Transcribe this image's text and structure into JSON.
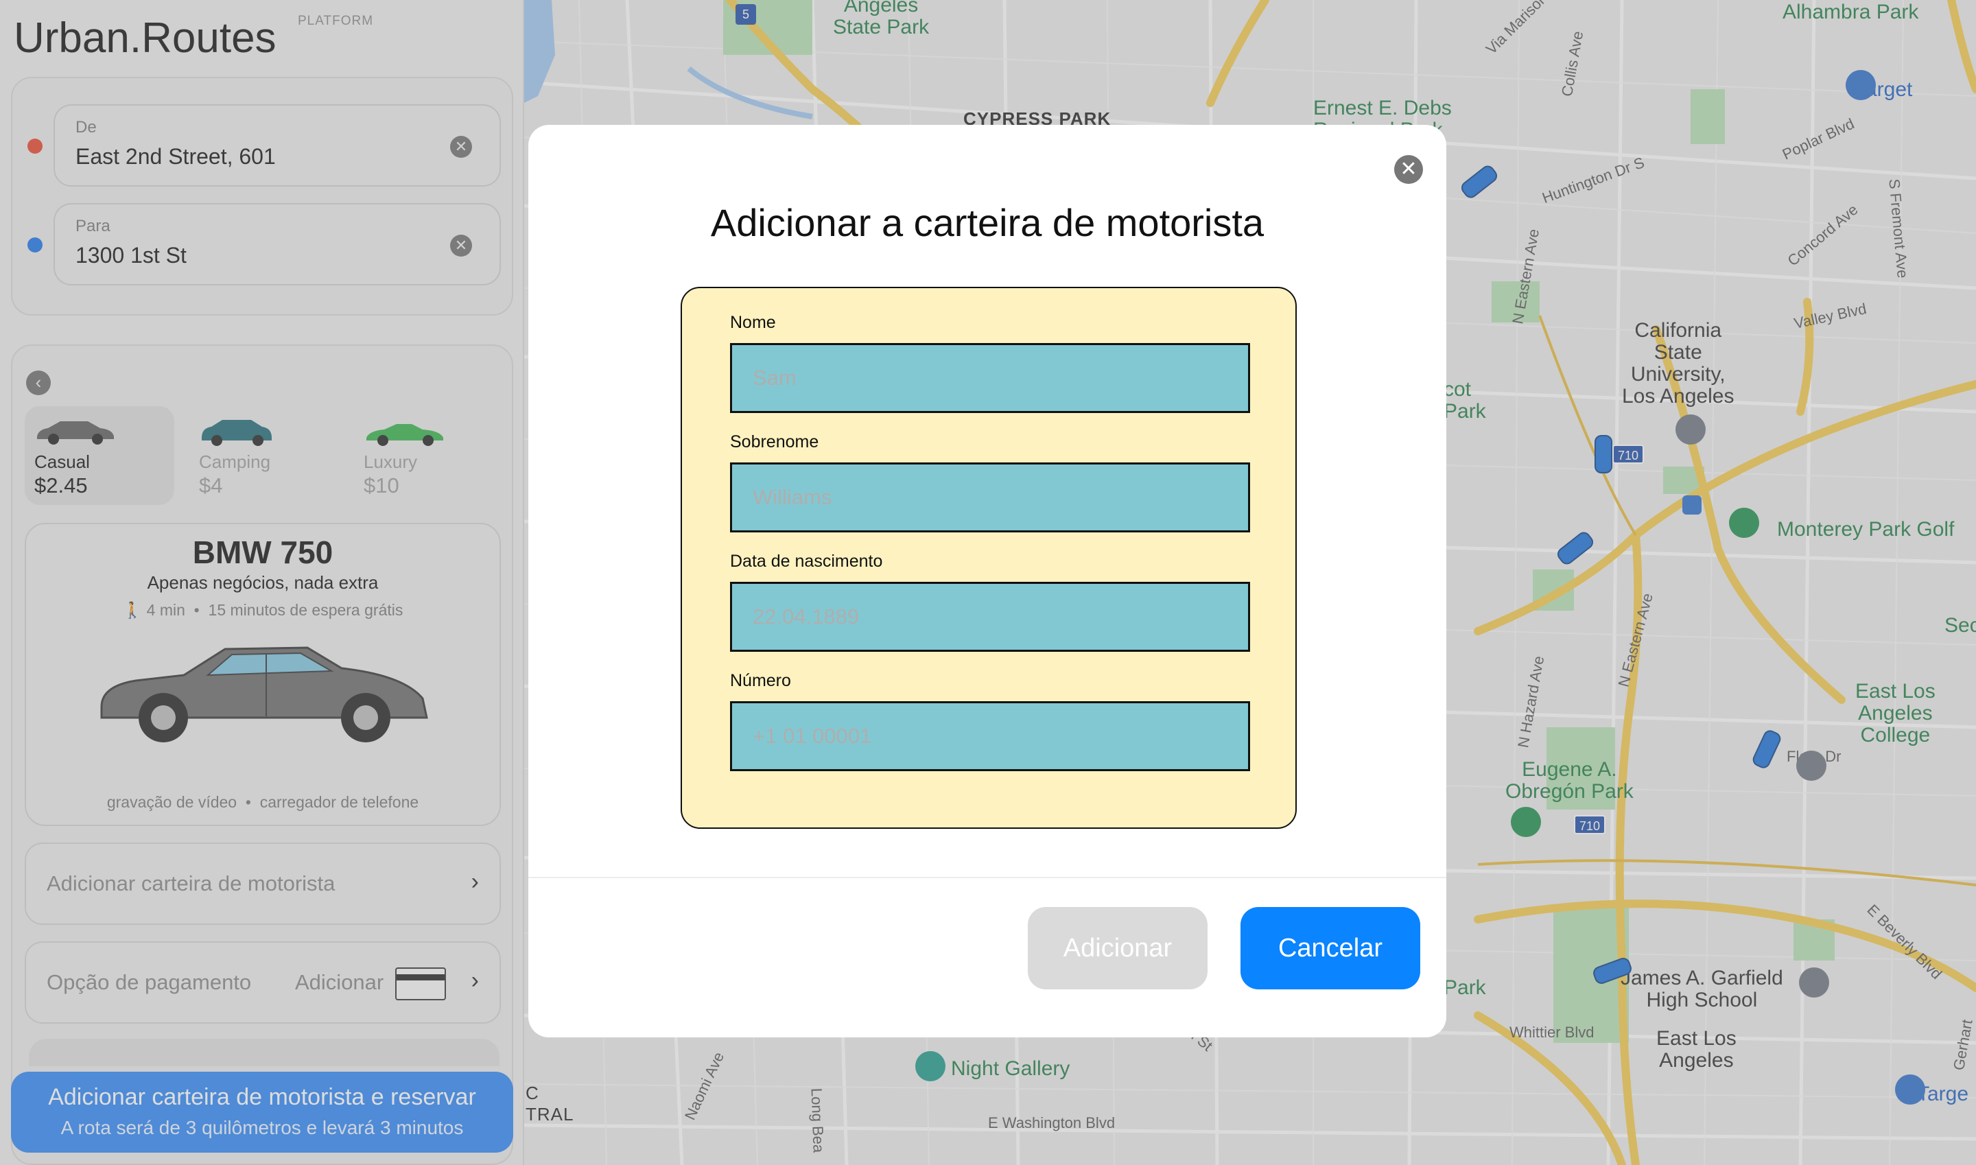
{
  "app": {
    "brand_main": "Urban",
    "brand_dot": ".",
    "brand_second": "Routes",
    "platform": "PLATFORM"
  },
  "route": {
    "from_label": "De",
    "from_value": "East 2nd Street, 601",
    "to_label": "Para",
    "to_value": "1300 1st St",
    "from_color": "#e8452c",
    "to_color": "#1a73e8",
    "clear_icon": "✕"
  },
  "tariffs": [
    {
      "name": "Casual",
      "price": "$2.45",
      "active": true
    },
    {
      "name": "Camping",
      "price": "$4",
      "active": false
    },
    {
      "name": "Luxury",
      "price": "$10",
      "active": false
    }
  ],
  "car_card": {
    "name": "BMW 750",
    "description": "Apenas negócios, nada extra",
    "walk_icon": "person-walking-icon",
    "walk_time": "4 min",
    "wait": "15 minutos de espera grátis",
    "feature_1": "gravação de vídeo",
    "feature_2": "carregador de telefone"
  },
  "options": {
    "license_label": "Adicionar carteira de motorista",
    "payment_label": "Opção de pagamento",
    "payment_add": "Adicionar",
    "chevron": "›"
  },
  "book_button": {
    "title": "Adicionar carteira de motorista e reservar",
    "subtitle": "A rota será de 3 quilômetros e levará 3 minutos"
  },
  "map": {
    "labels": {
      "angeles_sp": "Angeles\nState Park",
      "cypress_park": "CYPRESS PARK",
      "ernest_debs": "Ernest E. Debs\nRegional Park",
      "alhambra_park": "Alhambra Park",
      "target_1": "Target",
      "via_marisol": "Via Marisol",
      "collis_ave": "Collis Ave",
      "huntington": "Huntington Dr S",
      "poplar": "Poplar Blvd",
      "concord": "Concord Ave",
      "fremont": "S Fremont Ave",
      "valley": "Valley Blvd",
      "eastern_1": "N Eastern Ave",
      "csula": "California\nState\nUniversity,\nLos Angeles",
      "scot_park": "cot\nPark",
      "monterey": "Monterey Park Golf",
      "hazard": "N Hazard Ave",
      "eastern_2": "N Eastern Ave",
      "sec": "Sec",
      "elac": "East Los\nAngeles\nCollege",
      "obregon": "Eugene A.\nObregón Park",
      "flora": "Flora Dr",
      "beverly": "E Beverly Blvd",
      "park2": "Park",
      "garfield": "James A. Garfield\nHigh School",
      "whittier": "Whittier Blvd",
      "ela": "East Los\nAngeles",
      "gerhart": "Gerhart",
      "target_2": "Targe",
      "night_gallery": "Night Gallery",
      "naomi": "Naomi Ave",
      "long_beach": "Long Bea",
      "e_washington": "E Washington Blvd",
      "tral": "C\nTRAL",
      "st": "th St",
      "shield_5": "5",
      "shield_710a": "710",
      "shield_710b": "710"
    },
    "colors": {
      "highway": "#f2c94c",
      "road": "#ffffff",
      "park": "#b6dfb4",
      "water": "#9ec6f0",
      "car": "#1a6fd6"
    }
  },
  "modal": {
    "title": "Adicionar a carteira de motorista",
    "close_icon": "✕",
    "fields": [
      {
        "label": "Nome",
        "placeholder": "Sam"
      },
      {
        "label": "Sobrenome",
        "placeholder": "Williams"
      },
      {
        "label": "Data de nascimento",
        "placeholder": "22.04.1889"
      },
      {
        "label": "Número",
        "placeholder": "+1 01 00001"
      }
    ],
    "add_button": "Adicionar",
    "cancel_button": "Cancelar"
  }
}
